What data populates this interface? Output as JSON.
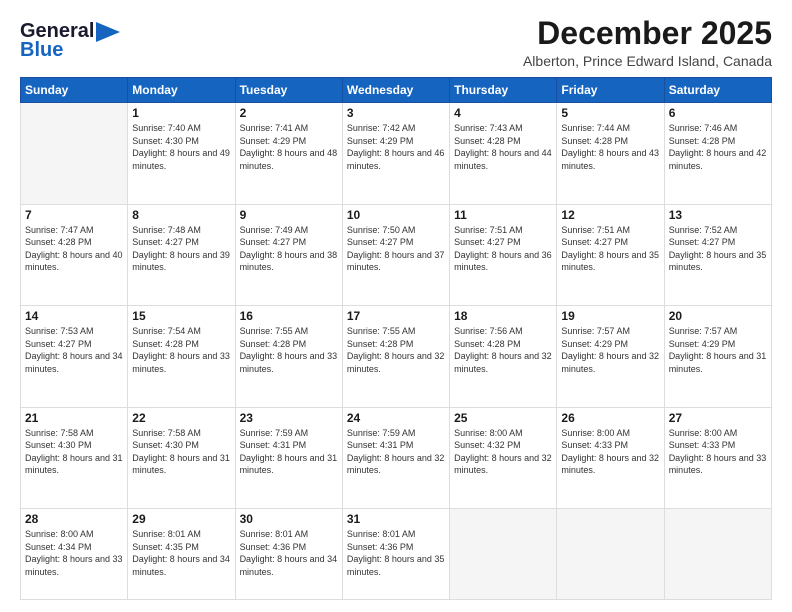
{
  "header": {
    "logo_line1": "General",
    "logo_line2": "Blue",
    "title": "December 2025",
    "subtitle": "Alberton, Prince Edward Island, Canada"
  },
  "columns": [
    "Sunday",
    "Monday",
    "Tuesday",
    "Wednesday",
    "Thursday",
    "Friday",
    "Saturday"
  ],
  "weeks": [
    [
      {
        "num": "",
        "sunrise": "",
        "sunset": "",
        "daylight": "",
        "empty": true
      },
      {
        "num": "1",
        "sunrise": "Sunrise: 7:40 AM",
        "sunset": "Sunset: 4:30 PM",
        "daylight": "Daylight: 8 hours and 49 minutes."
      },
      {
        "num": "2",
        "sunrise": "Sunrise: 7:41 AM",
        "sunset": "Sunset: 4:29 PM",
        "daylight": "Daylight: 8 hours and 48 minutes."
      },
      {
        "num": "3",
        "sunrise": "Sunrise: 7:42 AM",
        "sunset": "Sunset: 4:29 PM",
        "daylight": "Daylight: 8 hours and 46 minutes."
      },
      {
        "num": "4",
        "sunrise": "Sunrise: 7:43 AM",
        "sunset": "Sunset: 4:28 PM",
        "daylight": "Daylight: 8 hours and 44 minutes."
      },
      {
        "num": "5",
        "sunrise": "Sunrise: 7:44 AM",
        "sunset": "Sunset: 4:28 PM",
        "daylight": "Daylight: 8 hours and 43 minutes."
      },
      {
        "num": "6",
        "sunrise": "Sunrise: 7:46 AM",
        "sunset": "Sunset: 4:28 PM",
        "daylight": "Daylight: 8 hours and 42 minutes."
      }
    ],
    [
      {
        "num": "7",
        "sunrise": "Sunrise: 7:47 AM",
        "sunset": "Sunset: 4:28 PM",
        "daylight": "Daylight: 8 hours and 40 minutes."
      },
      {
        "num": "8",
        "sunrise": "Sunrise: 7:48 AM",
        "sunset": "Sunset: 4:27 PM",
        "daylight": "Daylight: 8 hours and 39 minutes."
      },
      {
        "num": "9",
        "sunrise": "Sunrise: 7:49 AM",
        "sunset": "Sunset: 4:27 PM",
        "daylight": "Daylight: 8 hours and 38 minutes."
      },
      {
        "num": "10",
        "sunrise": "Sunrise: 7:50 AM",
        "sunset": "Sunset: 4:27 PM",
        "daylight": "Daylight: 8 hours and 37 minutes."
      },
      {
        "num": "11",
        "sunrise": "Sunrise: 7:51 AM",
        "sunset": "Sunset: 4:27 PM",
        "daylight": "Daylight: 8 hours and 36 minutes."
      },
      {
        "num": "12",
        "sunrise": "Sunrise: 7:51 AM",
        "sunset": "Sunset: 4:27 PM",
        "daylight": "Daylight: 8 hours and 35 minutes."
      },
      {
        "num": "13",
        "sunrise": "Sunrise: 7:52 AM",
        "sunset": "Sunset: 4:27 PM",
        "daylight": "Daylight: 8 hours and 35 minutes."
      }
    ],
    [
      {
        "num": "14",
        "sunrise": "Sunrise: 7:53 AM",
        "sunset": "Sunset: 4:27 PM",
        "daylight": "Daylight: 8 hours and 34 minutes."
      },
      {
        "num": "15",
        "sunrise": "Sunrise: 7:54 AM",
        "sunset": "Sunset: 4:28 PM",
        "daylight": "Daylight: 8 hours and 33 minutes."
      },
      {
        "num": "16",
        "sunrise": "Sunrise: 7:55 AM",
        "sunset": "Sunset: 4:28 PM",
        "daylight": "Daylight: 8 hours and 33 minutes."
      },
      {
        "num": "17",
        "sunrise": "Sunrise: 7:55 AM",
        "sunset": "Sunset: 4:28 PM",
        "daylight": "Daylight: 8 hours and 32 minutes."
      },
      {
        "num": "18",
        "sunrise": "Sunrise: 7:56 AM",
        "sunset": "Sunset: 4:28 PM",
        "daylight": "Daylight: 8 hours and 32 minutes."
      },
      {
        "num": "19",
        "sunrise": "Sunrise: 7:57 AM",
        "sunset": "Sunset: 4:29 PM",
        "daylight": "Daylight: 8 hours and 32 minutes."
      },
      {
        "num": "20",
        "sunrise": "Sunrise: 7:57 AM",
        "sunset": "Sunset: 4:29 PM",
        "daylight": "Daylight: 8 hours and 31 minutes."
      }
    ],
    [
      {
        "num": "21",
        "sunrise": "Sunrise: 7:58 AM",
        "sunset": "Sunset: 4:30 PM",
        "daylight": "Daylight: 8 hours and 31 minutes."
      },
      {
        "num": "22",
        "sunrise": "Sunrise: 7:58 AM",
        "sunset": "Sunset: 4:30 PM",
        "daylight": "Daylight: 8 hours and 31 minutes."
      },
      {
        "num": "23",
        "sunrise": "Sunrise: 7:59 AM",
        "sunset": "Sunset: 4:31 PM",
        "daylight": "Daylight: 8 hours and 31 minutes."
      },
      {
        "num": "24",
        "sunrise": "Sunrise: 7:59 AM",
        "sunset": "Sunset: 4:31 PM",
        "daylight": "Daylight: 8 hours and 32 minutes."
      },
      {
        "num": "25",
        "sunrise": "Sunrise: 8:00 AM",
        "sunset": "Sunset: 4:32 PM",
        "daylight": "Daylight: 8 hours and 32 minutes."
      },
      {
        "num": "26",
        "sunrise": "Sunrise: 8:00 AM",
        "sunset": "Sunset: 4:33 PM",
        "daylight": "Daylight: 8 hours and 32 minutes."
      },
      {
        "num": "27",
        "sunrise": "Sunrise: 8:00 AM",
        "sunset": "Sunset: 4:33 PM",
        "daylight": "Daylight: 8 hours and 33 minutes."
      }
    ],
    [
      {
        "num": "28",
        "sunrise": "Sunrise: 8:00 AM",
        "sunset": "Sunset: 4:34 PM",
        "daylight": "Daylight: 8 hours and 33 minutes."
      },
      {
        "num": "29",
        "sunrise": "Sunrise: 8:01 AM",
        "sunset": "Sunset: 4:35 PM",
        "daylight": "Daylight: 8 hours and 34 minutes."
      },
      {
        "num": "30",
        "sunrise": "Sunrise: 8:01 AM",
        "sunset": "Sunset: 4:36 PM",
        "daylight": "Daylight: 8 hours and 34 minutes."
      },
      {
        "num": "31",
        "sunrise": "Sunrise: 8:01 AM",
        "sunset": "Sunset: 4:36 PM",
        "daylight": "Daylight: 8 hours and 35 minutes."
      },
      {
        "num": "",
        "sunrise": "",
        "sunset": "",
        "daylight": "",
        "empty": true
      },
      {
        "num": "",
        "sunrise": "",
        "sunset": "",
        "daylight": "",
        "empty": true
      },
      {
        "num": "",
        "sunrise": "",
        "sunset": "",
        "daylight": "",
        "empty": true
      }
    ]
  ]
}
